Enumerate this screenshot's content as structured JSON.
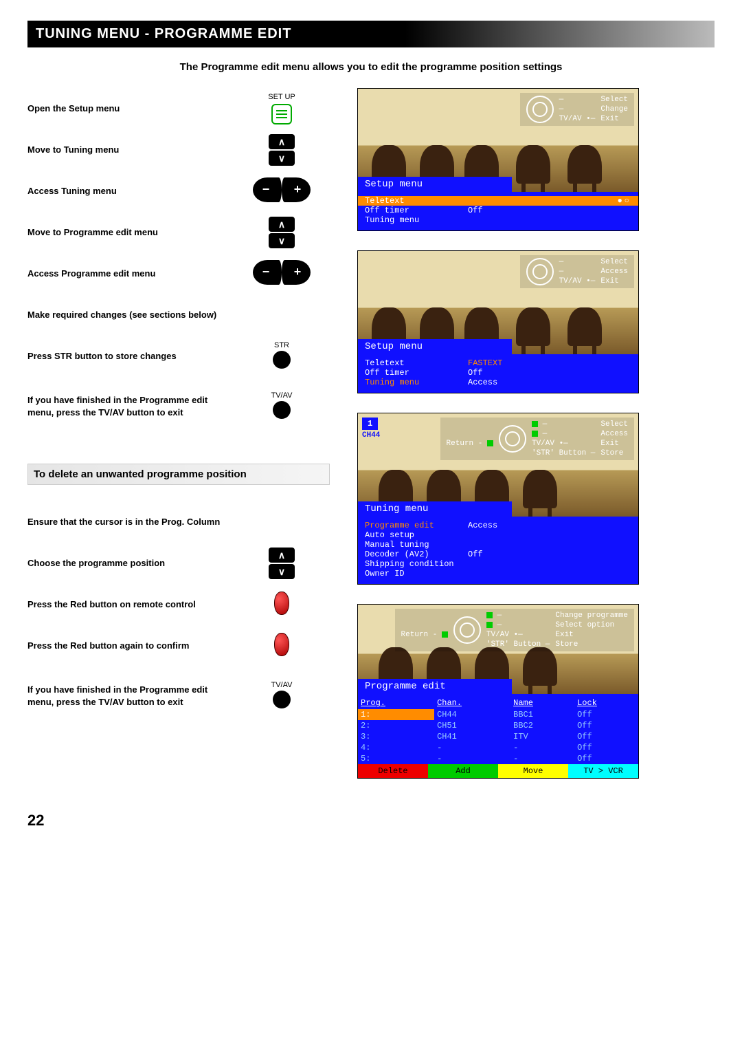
{
  "page_number": "22",
  "header": "TUNING MENU - PROGRAMME EDIT",
  "intro": "The Programme edit menu allows you to edit the programme position settings",
  "buttons": {
    "setup_caption": "SET UP",
    "str_caption": "STR",
    "tvav_caption": "TV/AV"
  },
  "steps_main": [
    "Open the Setup menu",
    "Move to Tuning menu",
    "Access Tuning menu",
    "Move to Programme edit menu",
    "Access Programme edit menu",
    "Make required changes (see sections below)",
    "Press STR button to store changes",
    "If you have finished in the Programme edit menu, press the TV/AV button to exit"
  ],
  "subhead_delete": "To delete an unwanted programme position",
  "steps_delete": [
    "Ensure that the cursor is in the Prog. Column",
    "Choose the programme position",
    "Press the Red button on remote control",
    "Press the Red button again to confirm",
    "If you have finished in the Programme edit menu, press the TV/AV button to exit"
  ],
  "hints": {
    "select": "Select",
    "change": "Change",
    "access": "Access",
    "exit": "Exit",
    "store": "Store",
    "tvav": "TV/AV",
    "return": "Return",
    "strbtn": "'STR' Button",
    "change_prog": "Change programme",
    "select_opt": "Select option"
  },
  "osd": {
    "setup_title": "Setup menu",
    "tuning_title": "Tuning menu",
    "progedit_title": "Programme edit",
    "teletext": "Teletext",
    "fastext": "FASTEXT",
    "offtimer": "Off timer",
    "off": "Off",
    "tuningmenu": "Tuning menu",
    "access": "Access",
    "tuning_items": [
      "Programme edit",
      "Auto setup",
      "Manual tuning",
      "Decoder (AV2)",
      "Shipping condition",
      "Owner ID"
    ],
    "pip_num": "1",
    "pip_ch": "CH44",
    "table_headers": [
      "Prog.",
      "Chan.",
      "Name",
      "Lock"
    ],
    "table_rows": [
      {
        "p": "1:",
        "c": "CH44",
        "n": "BBC1",
        "l": "Off"
      },
      {
        "p": "2:",
        "c": "CH51",
        "n": "BBC2",
        "l": "Off"
      },
      {
        "p": "3:",
        "c": "CH41",
        "n": "ITV",
        "l": "Off"
      },
      {
        "p": "4:",
        "c": "-",
        "n": "-",
        "l": "Off"
      },
      {
        "p": "5:",
        "c": "-",
        "n": "-",
        "l": "Off"
      }
    ],
    "actions": {
      "delete": "Delete",
      "add": "Add",
      "move": "Move",
      "tvvcr": "TV > VCR"
    }
  }
}
